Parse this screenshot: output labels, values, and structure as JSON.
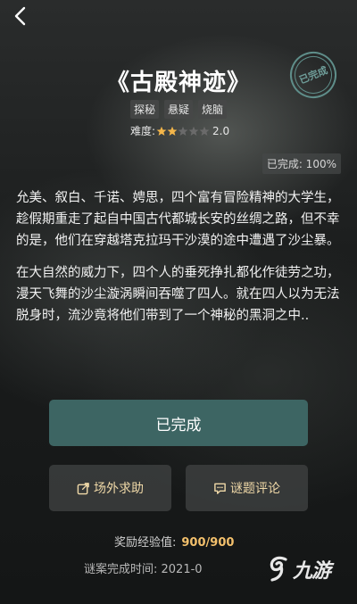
{
  "header": {
    "back_icon": "chevron-left-icon",
    "title": "《古殿神迹》",
    "stamp_text": "已完成"
  },
  "tags": [
    "探秘",
    "悬疑",
    "烧脑"
  ],
  "difficulty": {
    "label": "难度:",
    "rating": 2,
    "max": 5,
    "value_text": "2.0",
    "star_color": "#f2b54a",
    "empty_star_color": "#6a6a6a"
  },
  "progress": {
    "text": "已完成: 100%"
  },
  "story": {
    "paragraph1": "允美、叙白、千诺、娉思，四个富有冒险精神的大学生，趁假期重走了起自中国古代都城长安的丝绸之路，但不幸的是，他们在穿越塔克拉玛干沙漠的途中遭遇了沙尘暴。",
    "paragraph2": "在大自然的威力下，四个人的垂死挣扎都化作徒劳之功，漫天飞舞的沙尘漩涡瞬间吞噬了四人。就在四人以为无法脱身时，流沙竟将他们带到了一个神秘的黑洞之中.."
  },
  "buttons": {
    "done_label": "已完成",
    "help_label": "场外求助",
    "help_icon": "share-icon",
    "comment_label": "谜题评论",
    "comment_icon": "comment-icon"
  },
  "reward": {
    "label": "奖励经验值:",
    "value": "900/900"
  },
  "completion": {
    "text": "谜案完成时间:  2021-0"
  },
  "watermark": {
    "text": "九游"
  },
  "colors": {
    "accent": "#3d6563",
    "gold": "#f3c06c",
    "button_text": "#f0d9a8"
  }
}
